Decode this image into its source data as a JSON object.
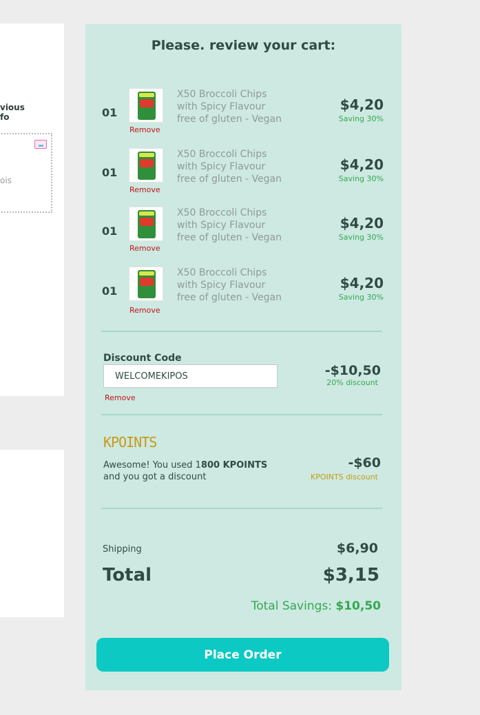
{
  "left_panel": {
    "text_line1": "vious",
    "text_line2": "fo",
    "box_text": "ois"
  },
  "cart": {
    "title": "Please. review your cart:",
    "items": [
      {
        "qty": "01",
        "name": "X50 Broccoli Chips with Spicy Flavour free of gluten - Vegan",
        "price": "$4,20",
        "saving": "Saving 30%",
        "remove": "Remove"
      },
      {
        "qty": "01",
        "name": "X50 Broccoli Chips with Spicy Flavour free of gluten - Vegan",
        "price": "$4,20",
        "saving": "Saving 30%",
        "remove": "Remove"
      },
      {
        "qty": "01",
        "name": "X50 Broccoli Chips with Spicy Flavour free of gluten - Vegan",
        "price": "$4,20",
        "saving": "Saving 30%",
        "remove": "Remove"
      },
      {
        "qty": "01",
        "name": "X50 Broccoli Chips with Spicy Flavour free of gluten - Vegan",
        "price": "$4,20",
        "saving": "Saving 30%",
        "remove": "Remove"
      }
    ],
    "discount": {
      "label": "Discount Code",
      "value": "WELCOMEKIPOS",
      "remove": "Remove",
      "amount": "-$10,50",
      "note": "20% discount"
    },
    "kpoints": {
      "logo": "KPOINTS",
      "msg_prefix": "Awesome! You used 1",
      "msg_bold": "800 KPOINTS",
      "msg_suffix": "and you got a discount",
      "amount": "-$60",
      "note": "KPOINTS discount"
    },
    "shipping": {
      "label": "Shipping",
      "value": "$6,90"
    },
    "total": {
      "label": "Total",
      "value": "$3,15"
    },
    "savings": {
      "label": "Total Savings: ",
      "value": "$10,50"
    },
    "place_order": "Place Order"
  },
  "colors": {
    "panel_bg": "#cde9e1",
    "accent": "#0ccac3",
    "saving_green": "#34a853",
    "remove_red": "#c0141c",
    "kpoints_gold": "#c69a17"
  }
}
